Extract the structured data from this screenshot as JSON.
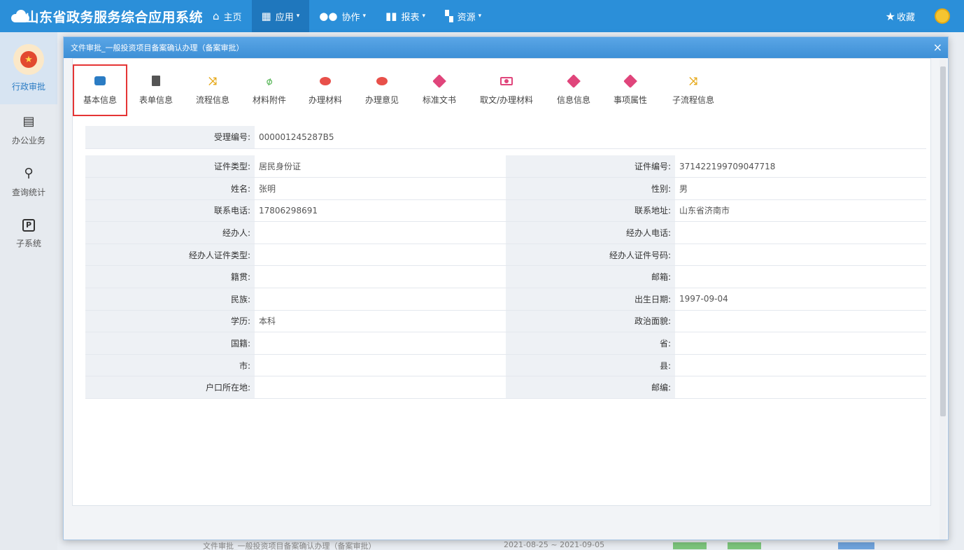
{
  "app": {
    "title": "山东省政务服务综合应用系统",
    "nav": [
      {
        "icon": "home-icon",
        "glyph": "⌂",
        "label": "主页",
        "caret": false
      },
      {
        "icon": "grid-icon",
        "glyph": "▦",
        "label": "应用",
        "caret": true
      },
      {
        "icon": "collab-icon",
        "glyph": "●●",
        "label": "协作",
        "caret": true
      },
      {
        "icon": "bar-chart-icon",
        "glyph": "▮▮",
        "label": "报表",
        "caret": true
      },
      {
        "icon": "resource-icon",
        "glyph": "▚",
        "label": "资源",
        "caret": true
      }
    ],
    "favorite_label": "收藏"
  },
  "sidebar": {
    "items": [
      {
        "label": "行政审批"
      },
      {
        "label": "办公业务"
      },
      {
        "label": "查询统计"
      },
      {
        "label": "子系统"
      }
    ]
  },
  "modal": {
    "title": "文件审批_一般投资项目备案确认办理（备案审批）",
    "close_glyph": "×",
    "tabs": [
      {
        "label": "基本信息",
        "icon": "mail-icon"
      },
      {
        "label": "表单信息",
        "icon": "document-icon"
      },
      {
        "label": "流程信息",
        "icon": "shuffle-icon"
      },
      {
        "label": "材料附件",
        "icon": "paperclip-icon"
      },
      {
        "label": "办理材料",
        "icon": "chat-icon"
      },
      {
        "label": "办理意见",
        "icon": "chat-icon"
      },
      {
        "label": "标准文书",
        "icon": "tag-icon"
      },
      {
        "label": "取文/办理材料",
        "icon": "money-icon"
      },
      {
        "label": "信息信息",
        "icon": "tag-icon"
      },
      {
        "label": "事项属性",
        "icon": "tag-icon"
      },
      {
        "label": "子流程信息",
        "icon": "shuffle-icon"
      }
    ],
    "receipt": {
      "label": "受理编号:",
      "value": "000001245287B5"
    },
    "fields": [
      [
        {
          "label": "证件类型:",
          "value": "居民身份证"
        },
        {
          "label": "证件编号:",
          "value": "371422199709047718"
        }
      ],
      [
        {
          "label": "姓名:",
          "value": "张明"
        },
        {
          "label": "性别:",
          "value": "男"
        }
      ],
      [
        {
          "label": "联系电话:",
          "value": "17806298691"
        },
        {
          "label": "联系地址:",
          "value": "山东省济南市"
        }
      ],
      [
        {
          "label": "经办人:",
          "value": ""
        },
        {
          "label": "经办人电话:",
          "value": ""
        }
      ],
      [
        {
          "label": "经办人证件类型:",
          "value": ""
        },
        {
          "label": "经办人证件号码:",
          "value": ""
        }
      ],
      [
        {
          "label": "籍贯:",
          "value": ""
        },
        {
          "label": "邮箱:",
          "value": ""
        }
      ],
      [
        {
          "label": "民族:",
          "value": ""
        },
        {
          "label": "出生日期:",
          "value": "1997-09-04"
        }
      ],
      [
        {
          "label": "学历:",
          "value": "本科"
        },
        {
          "label": "政治面貌:",
          "value": ""
        }
      ],
      [
        {
          "label": "国籍:",
          "value": ""
        },
        {
          "label": "省:",
          "value": ""
        }
      ],
      [
        {
          "label": "市:",
          "value": ""
        },
        {
          "label": "县:",
          "value": ""
        }
      ],
      [
        {
          "label": "户口所在地:",
          "value": ""
        },
        {
          "label": "邮编:",
          "value": ""
        }
      ]
    ]
  },
  "background_row": {
    "text": "文件审批_一般投资项目备案确认办理（备案审批）",
    "dates": "2021-08-25 ~ 2021-09-05"
  }
}
